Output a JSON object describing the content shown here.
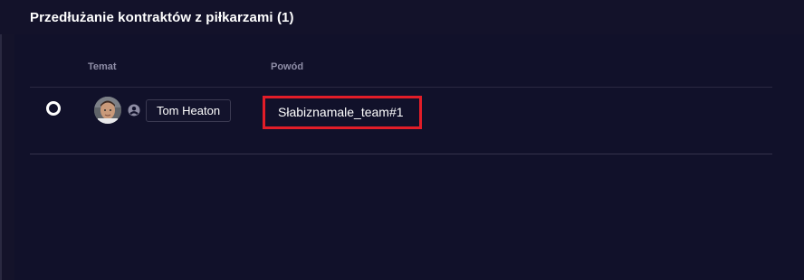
{
  "section": {
    "title": "Przedłużanie kontraktów z piłkarzami (1)"
  },
  "table": {
    "columns": [
      "Temat",
      "Powód"
    ],
    "rows": [
      {
        "player_name": "Tom Heaton",
        "reason": "Słabiznamale_team#1",
        "selected": false
      }
    ]
  },
  "colors": {
    "background": "#11112a",
    "highlight": "#e21d28",
    "text": "#ffffff",
    "muted": "#8f8ea7"
  },
  "icons": [
    "radio-button-icon",
    "player-avatar",
    "person-icon"
  ]
}
